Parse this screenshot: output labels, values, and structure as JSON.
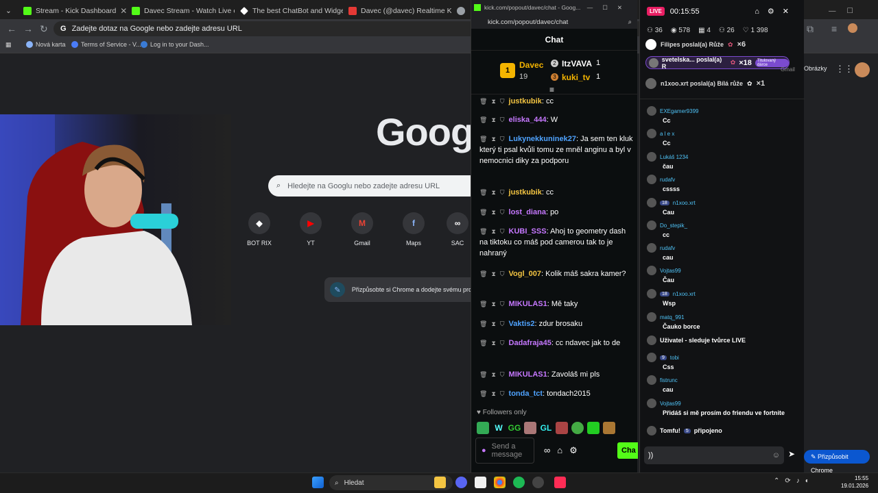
{
  "tabs": [
    {
      "title": "Stream - Kick Dashboard",
      "favcolor": "#53fc18"
    },
    {
      "title": "Davec Stream - Watch Live on K",
      "favcolor": "#53fc18"
    },
    {
      "title": "The best ChatBot and Widgets",
      "favcolor": "#ffffff"
    },
    {
      "title": "Davec (@davec) Realtime Kick",
      "favcolor": "#e53935"
    },
    {
      "title": "",
      "favcolor": "#9aa0a6"
    }
  ],
  "omnibox": {
    "placeholder": "Zadejte dotaz na Google nebo zadejte adresu URL"
  },
  "bookmarks": [
    "Nová karta",
    "Terms of Service - V...",
    "Log in to your Dash..."
  ],
  "google": {
    "logo": "Goog",
    "search_placeholder": "Hledejte na Googlu nebo zadejte adresu URL",
    "shortcuts": [
      {
        "label": "BOT RIX",
        "glyph": "◆",
        "color": "#ffffff"
      },
      {
        "label": "YT",
        "glyph": "▶",
        "color": "#ff0000"
      },
      {
        "label": "Gmail",
        "glyph": "M",
        "color": "#ea4335"
      },
      {
        "label": "Maps",
        "glyph": "f",
        "color": "#8ab4f8"
      },
      {
        "label": "SAC",
        "glyph": "∞",
        "color": "#ffffff"
      }
    ],
    "customize": "Přizpůsobte si Chrome a dodejte svému pro",
    "images_link": "Obrázky",
    "customize_chrome": "Přizpůsobit Chrome"
  },
  "popout": {
    "window_title": "kick.com/popout/davec/chat - Goog...",
    "url": "kick.com/popout/davec/chat",
    "chat_title": "Chat",
    "leaderboard": {
      "first": {
        "rank": "1",
        "name": "Davec",
        "count": "19"
      },
      "second": {
        "rank": "2",
        "name": "ItzVAVA",
        "count": "1"
      },
      "third": {
        "rank": "3",
        "name": "kuki_tv",
        "count": "1"
      }
    },
    "messages": [
      {
        "user": "justkubik",
        "text": "cc",
        "color": "#f4c542"
      },
      {
        "user": "eliska_444",
        "text": "W",
        "color": "#c678ff"
      },
      {
        "user": "Lukynekkuninek27",
        "text": "Ja sem ten kluk který ti psal kvůli tomu ze mněl anginu a byl v nemocnici diky za podporu",
        "color": "#4fa3ff"
      },
      {
        "user": "justkubik",
        "text": "cc",
        "color": "#f4c542"
      },
      {
        "user": "lost_diana",
        "text": "po",
        "color": "#c678ff"
      },
      {
        "user": "KUBI_SSS",
        "text": "Ahoj to geometry dash na tiktoku co máš pod camerou tak to je nahraný",
        "color": "#c678ff"
      },
      {
        "user": "Vogl_007",
        "text": "Kolik máš sakra kamer?",
        "color": "#f4c542"
      },
      {
        "user": "MIKULAS1",
        "text": "Mě taky",
        "color": "#c678ff"
      },
      {
        "user": "Vaktis2",
        "text": "zdur brosaku",
        "color": "#4fa3ff"
      },
      {
        "user": "Dadafraja45",
        "text": "cc ndavec jak to de",
        "color": "#c678ff"
      },
      {
        "user": "MIKULAS1",
        "text": "Zavoláš mi pls",
        "color": "#c678ff"
      },
      {
        "user": "tonda_tct",
        "text": "tondach2015",
        "color": "#4fa3ff"
      }
    ],
    "followers_only": "Followers only",
    "emotes": [
      "W",
      "GG",
      "GL"
    ],
    "send_placeholder": "Send a message",
    "chat_button": "Cha"
  },
  "overlay": {
    "live_badge": "LIVE",
    "timer": "00:15:55",
    "stats": [
      {
        "icon": "people-icon",
        "value": "36"
      },
      {
        "icon": "eye-icon",
        "value": "578"
      },
      {
        "icon": "grid-icon",
        "value": "4"
      },
      {
        "icon": "people-icon",
        "value": "26"
      },
      {
        "icon": "heart-icon",
        "value": "1 398"
      }
    ],
    "gifts": [
      {
        "text": "Filipes poslal(a) Růže",
        "mult": "×6"
      },
      {
        "text": "svetelska... poslal(a) R",
        "mult": "×18",
        "badge": "Titulovaný dárce"
      },
      {
        "text": "n1xoo.xrt poslal(a) Bílá růže",
        "mult": "×1"
      }
    ],
    "gmail_label": "Gmail",
    "messages": [
      {
        "user": "EXEgamer9399",
        "text": "Cc",
        "badge": ""
      },
      {
        "user": "a l e x",
        "text": "Cc",
        "badge": ""
      },
      {
        "user": "Lukáš 1234",
        "text": "čau",
        "badge": ""
      },
      {
        "user": "rudafv",
        "text": "cssss",
        "badge": ""
      },
      {
        "user": "n1xoo.xrt",
        "text": "Cau",
        "badge": "18"
      },
      {
        "user": "Do_stepik_",
        "text": "cc",
        "badge": ""
      },
      {
        "user": "rudafv",
        "text": "cau",
        "badge": ""
      },
      {
        "user": "Vojtas99",
        "text": "Čau",
        "badge": ""
      },
      {
        "user": "n1xoo.xrt",
        "text": "Wsp",
        "badge": "18"
      },
      {
        "user": "matq_991",
        "text": "Čauko borce",
        "badge": ""
      },
      {
        "user": "tobi",
        "text": "Css",
        "badge": "9"
      },
      {
        "user": "fistrunc",
        "text": "cau",
        "badge": ""
      },
      {
        "user": "Vojtas99",
        "text": "Přidáš si mě prosím do friendu ve fortnite",
        "badge": ""
      }
    ],
    "follow_event": "Uživatel - sleduje tvůrce LIVE",
    "join_event": {
      "user": "Tomfu!",
      "badge": "5",
      "text": "připojeno"
    },
    "input_value": "))"
  },
  "taskbar": {
    "search": "Hledat",
    "time": "15:55",
    "date": "19.01.2026"
  }
}
